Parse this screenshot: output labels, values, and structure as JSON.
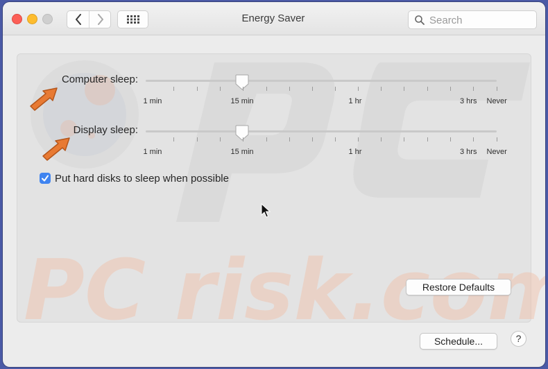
{
  "window": {
    "title": "Energy Saver"
  },
  "search": {
    "placeholder": "Search",
    "value": ""
  },
  "computer_sleep": {
    "label": "Computer sleep:",
    "value": "15 min"
  },
  "display_sleep": {
    "label": "Display sleep:",
    "value": "15 min"
  },
  "slider_ticks": [
    "1 min",
    "15 min",
    "1 hr",
    "3 hrs",
    "Never"
  ],
  "hard_disk_option": {
    "label": "Put hard disks to sleep when possible",
    "checked": true
  },
  "buttons": {
    "restore_defaults": "Restore Defaults",
    "schedule": "Schedule...",
    "help": "?"
  },
  "watermark": {
    "text": "PC risk.com"
  },
  "colors": {
    "desktop": "#4b5aa6",
    "checkbox_accent": "#3f84f0",
    "arrow_annotation": "#e87a33"
  }
}
